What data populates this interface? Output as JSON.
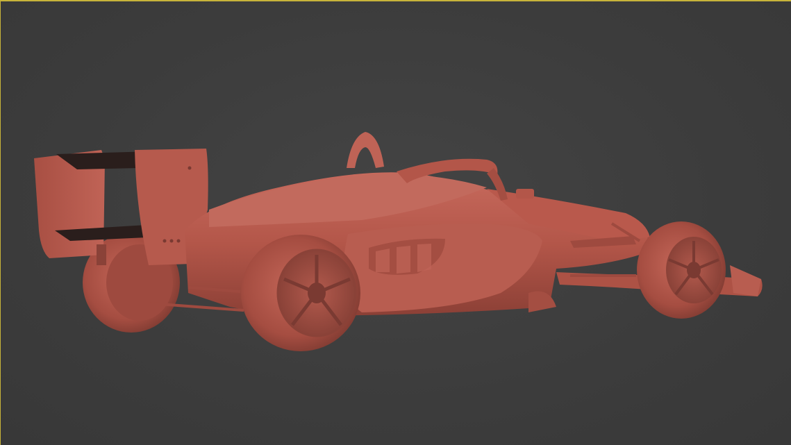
{
  "viewport": {
    "border_color": "#c8b43a",
    "background_color": "#3d3d3d"
  },
  "model": {
    "material_color": "#b5574a",
    "shadow_color": "#7a3a32",
    "highlight_color": "#cf7366"
  }
}
